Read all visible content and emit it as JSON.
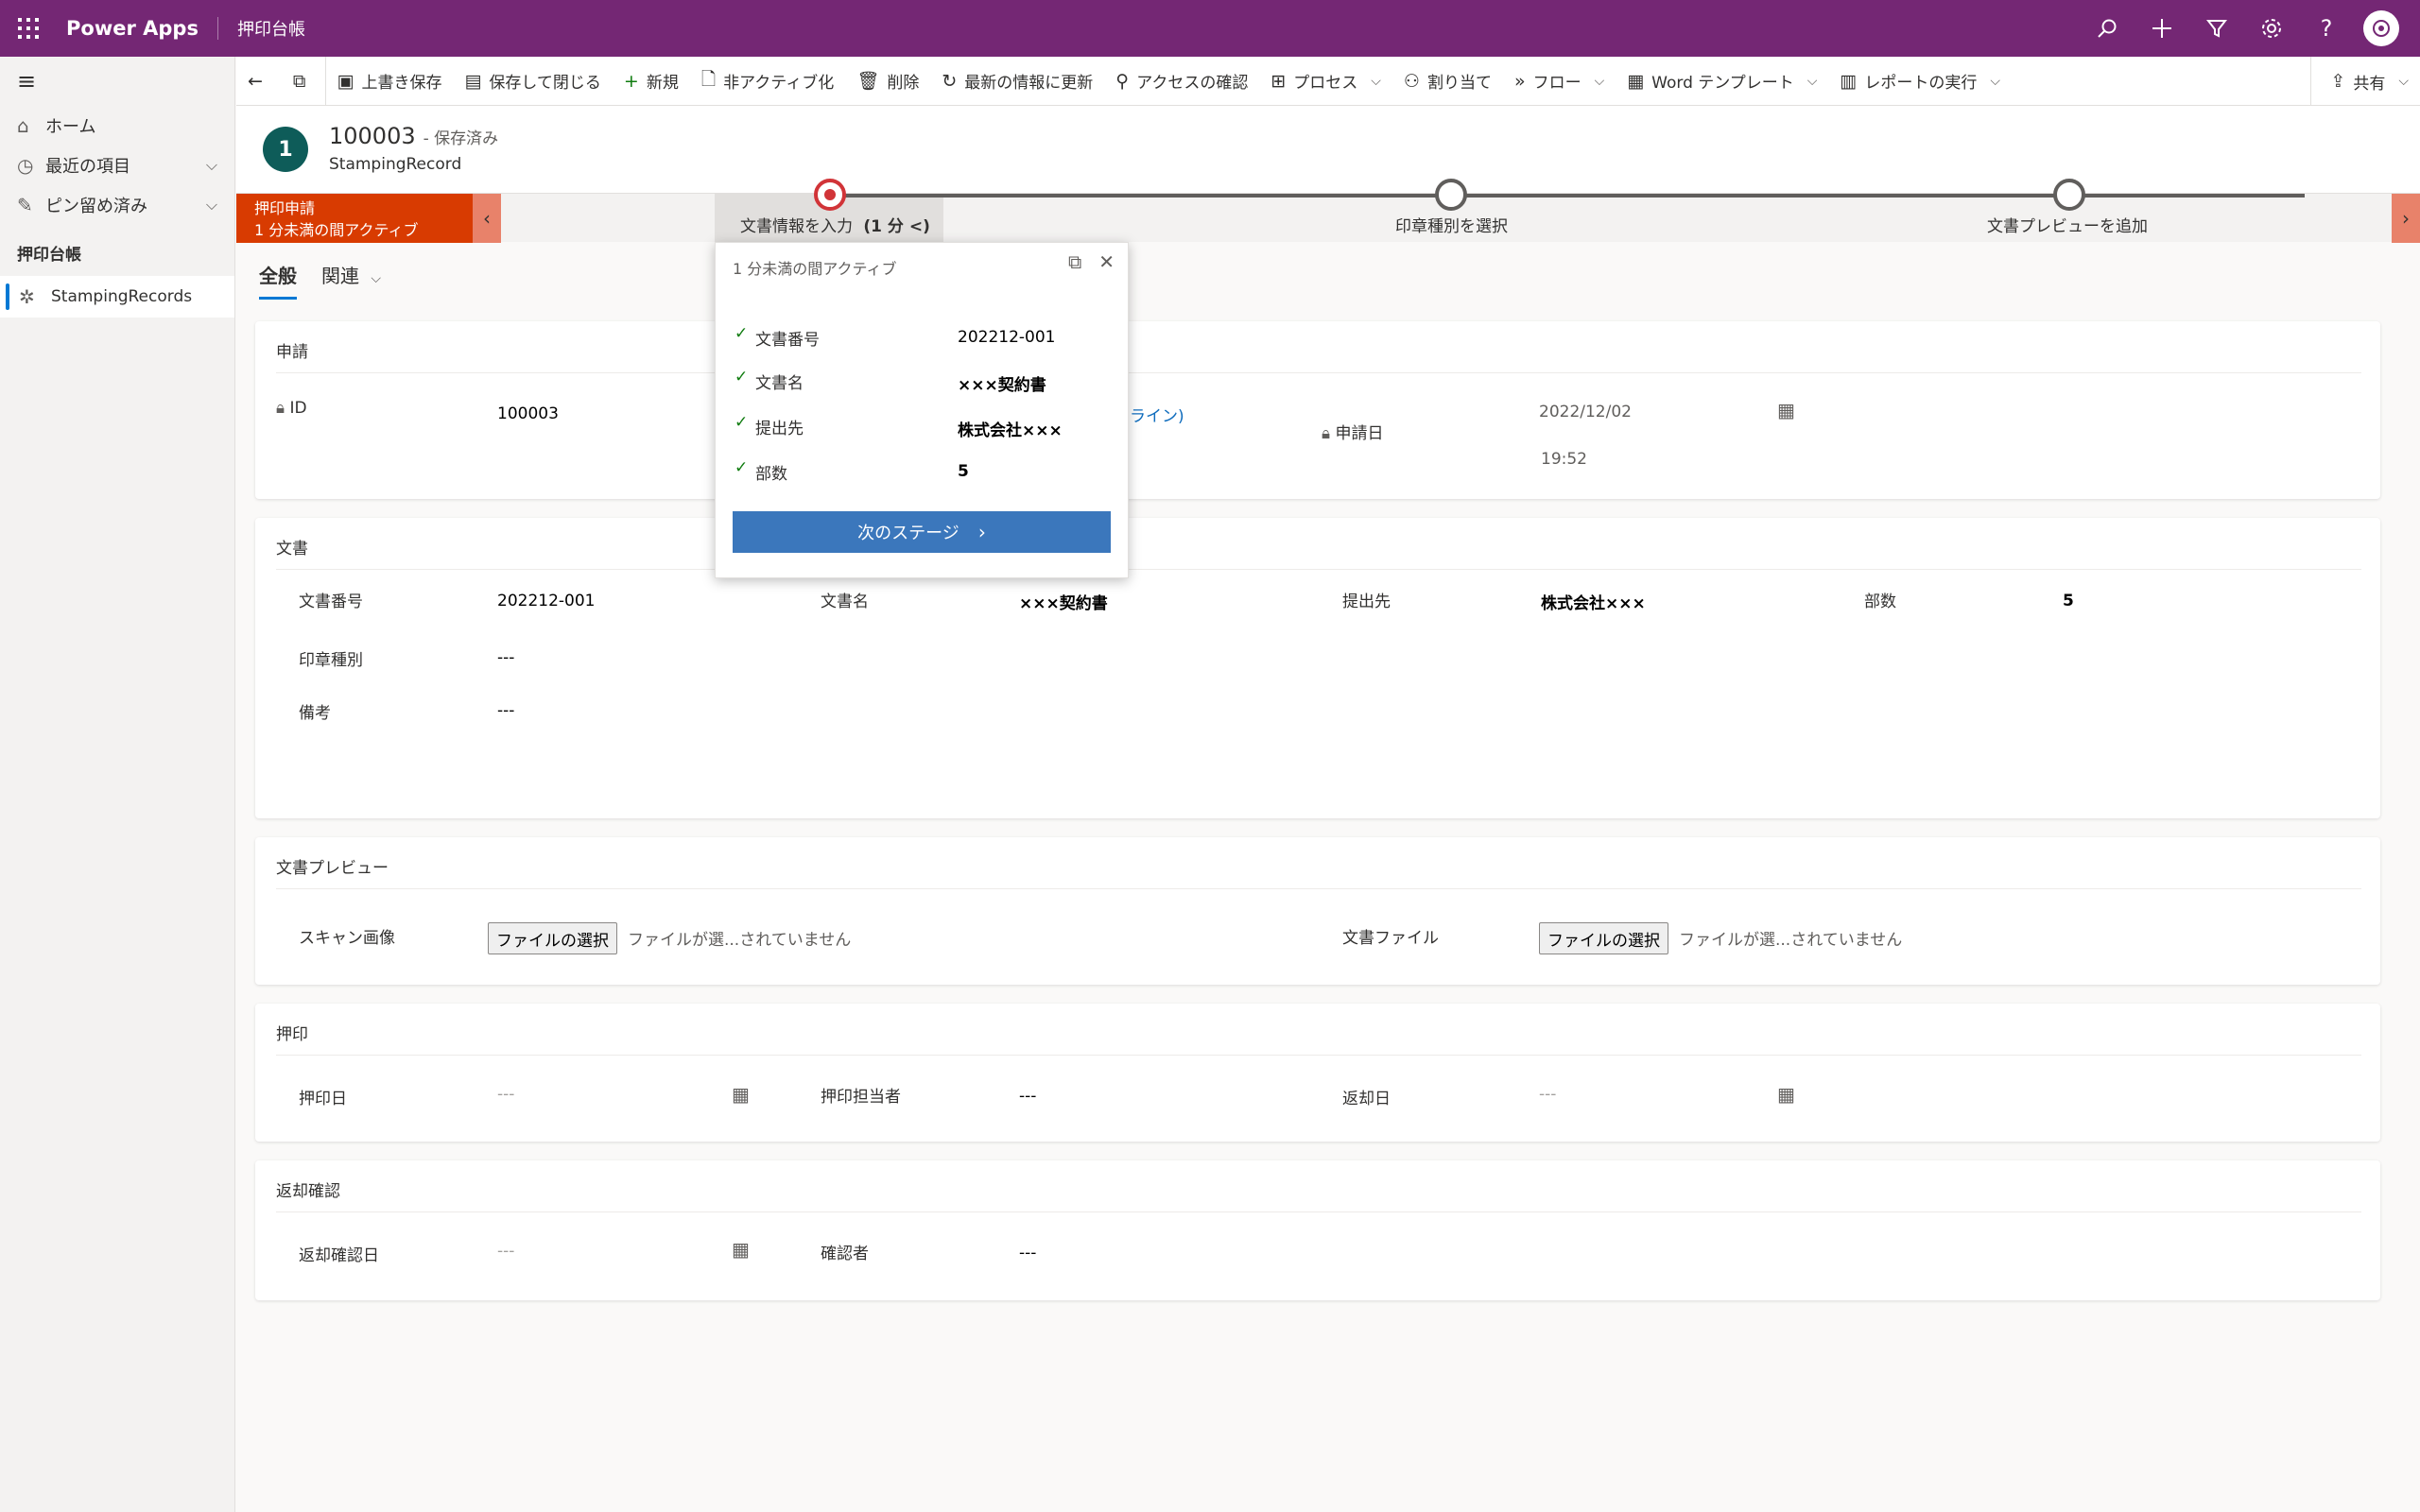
{
  "topbar": {
    "app_name": "Power Apps",
    "app_title": "押印台帳",
    "icons": [
      "search-icon",
      "add-icon",
      "filter-icon",
      "settings-icon",
      "help-icon",
      "avatar"
    ],
    "brand_color": "#742774"
  },
  "sidebar": {
    "items": [
      {
        "label": "ホーム",
        "icon": "home-icon"
      },
      {
        "label": "最近の項目",
        "icon": "clock-icon"
      },
      {
        "label": "ピン留め済み",
        "icon": "pin-icon"
      }
    ],
    "group_label": "押印台帳",
    "active_item": {
      "label": "StampingRecords",
      "icon": "puzzle-icon"
    }
  },
  "commands": [
    {
      "label": "上書き保存",
      "icon": "save-icon"
    },
    {
      "label": "保存して閉じる",
      "icon": "save-close-icon"
    },
    {
      "label": "新規",
      "icon": "plus-icon"
    },
    {
      "label": "非アクティブ化",
      "icon": "deactivate-icon"
    },
    {
      "label": "削除",
      "icon": "trash-icon"
    },
    {
      "label": "最新の情報に更新",
      "icon": "refresh-icon"
    },
    {
      "label": "アクセスの確認",
      "icon": "key-icon"
    },
    {
      "label": "プロセス",
      "icon": "process-icon"
    },
    {
      "label": "割り当て",
      "icon": "assign-icon"
    },
    {
      "label": "フロー",
      "icon": "flow-icon"
    },
    {
      "label": "Word テンプレート",
      "icon": "word-icon"
    },
    {
      "label": "レポートの実行",
      "icon": "report-icon"
    }
  ],
  "share_label": "共有",
  "record": {
    "avatar_letter": "1",
    "title": "100003",
    "status": "- 保存済み",
    "entity": "StampingRecord"
  },
  "bpf": {
    "flag_title": "押印申請",
    "flag_sub": "1 分未満の間アクティブ",
    "stages": [
      {
        "label": "文書情報を入力",
        "duration": "(1 分 <)",
        "active": true
      },
      {
        "label": "印章種別を選択",
        "active": false
      },
      {
        "label": "文書プレビューを追加",
        "active": false
      }
    ]
  },
  "tabs": {
    "general": "全般",
    "related": "関連"
  },
  "flyout": {
    "header": "1 分未満の間アクティブ",
    "fields": [
      {
        "label": "文書番号",
        "value": "202212-001"
      },
      {
        "label": "文書名",
        "value": "×××契約書"
      },
      {
        "label": "提出先",
        "value": "株式会社×××"
      },
      {
        "label": "部数",
        "value": "5"
      }
    ],
    "next_button": "次のステージ"
  },
  "sections": {
    "apply": {
      "title": "申請",
      "id_label": "ID",
      "id_value": "100003",
      "owner_link_fragment": "ライン)",
      "date_label": "申請日",
      "date_value": "2022/12/02",
      "time_value": "19:52"
    },
    "document": {
      "title": "文書",
      "doc_no_label": "文書番号",
      "doc_no_value": "202212-001",
      "doc_name_label": "文書名",
      "doc_name_value": "×××契約書",
      "submit_label": "提出先",
      "submit_value": "株式会社×××",
      "copies_label": "部数",
      "copies_value": "5",
      "seal_type_label": "印章種別",
      "seal_type_value": "---",
      "note_label": "備考",
      "note_value": "---"
    },
    "preview": {
      "title": "文書プレビュー",
      "scan_label": "スキャン画像",
      "file_label": "文書ファイル",
      "choose_button": "ファイルの選択",
      "no_file_text": "ファイルが選...されていません"
    },
    "stamp": {
      "title": "押印",
      "stamp_date_label": "押印日",
      "stamp_date_value": "---",
      "stamp_person_label": "押印担当者",
      "stamp_person_value": "---",
      "return_date_label": "返却日",
      "return_date_value": "---"
    },
    "return_confirm": {
      "title": "返却確認",
      "date_label": "返却確認日",
      "date_value": "---",
      "confirmer_label": "確認者",
      "confirmer_value": "---"
    }
  }
}
